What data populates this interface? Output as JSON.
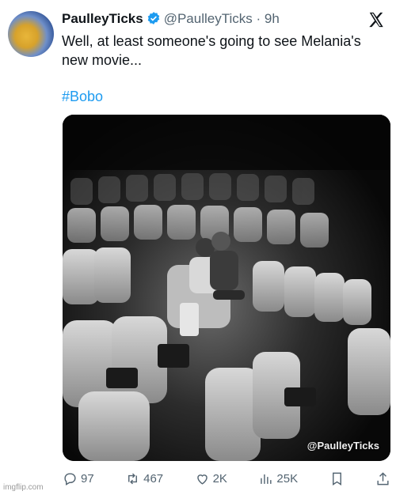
{
  "tweet": {
    "name": "PaulleyTicks",
    "handle": "@PaulleyTicks",
    "dot": "·",
    "time": "9h",
    "text": "Well, at least someone's going to see Melania's new movie...",
    "hashtag": "#Bobo",
    "media_watermark": "@PaulleyTicks"
  },
  "actions": {
    "replies": "97",
    "reposts": "467",
    "likes": "2K",
    "views": "25K"
  },
  "site_watermark": "imgflip.com",
  "colors": {
    "accent": "#1d9bf0",
    "muted": "#536471",
    "text": "#0f1419"
  }
}
